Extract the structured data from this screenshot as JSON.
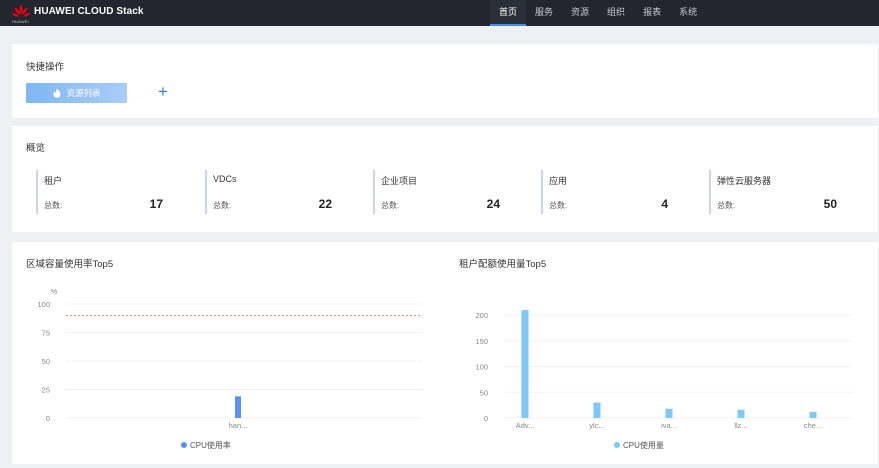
{
  "header": {
    "brand": "HUAWEI CLOUD Stack",
    "logo_caption": "HUAWEI",
    "nav": [
      "首页",
      "服务",
      "资源",
      "组织",
      "报表",
      "系统"
    ],
    "active_nav": "首页"
  },
  "quick_actions": {
    "title": "快捷操作",
    "resource_list_button": "资源列表",
    "add_icon": "plus-icon"
  },
  "overview": {
    "title": "概览",
    "total_label": "总数:",
    "stats": [
      {
        "name": "租户",
        "value": "17"
      },
      {
        "name": "VDCs",
        "value": "22"
      },
      {
        "name": "企业项目",
        "value": "24"
      },
      {
        "name": "应用",
        "value": "4"
      },
      {
        "name": "弹性云服务器",
        "value": "50"
      }
    ]
  },
  "chart_data": [
    {
      "type": "bar",
      "title": "区域容量使用率Top5",
      "ylabel": "%",
      "yticks": [
        0,
        25,
        50,
        75,
        100
      ],
      "ylim": [
        0,
        100
      ],
      "threshold": 90,
      "categories": [
        "han..."
      ],
      "series": [
        {
          "name": "CPU使用率",
          "values": [
            19
          ],
          "color": "#5b8ff9"
        }
      ],
      "grid": true,
      "legend": "bottom"
    },
    {
      "type": "bar",
      "title": "租户配额使用量Top5",
      "yticks": [
        0,
        50,
        100,
        150,
        200
      ],
      "ylim": [
        0,
        210
      ],
      "categories": [
        "Adv...",
        "ylc...",
        "iva...",
        "llz...",
        "che..."
      ],
      "series": [
        {
          "name": "CPU使用量",
          "values": [
            210,
            30,
            18,
            16,
            12
          ],
          "color": "#7cc8f8"
        }
      ],
      "grid": true,
      "legend": "bottom"
    }
  ],
  "colors": {
    "topbar": "#23262e",
    "accent": "#4a90e2",
    "threshold_line": "#e8684a"
  }
}
